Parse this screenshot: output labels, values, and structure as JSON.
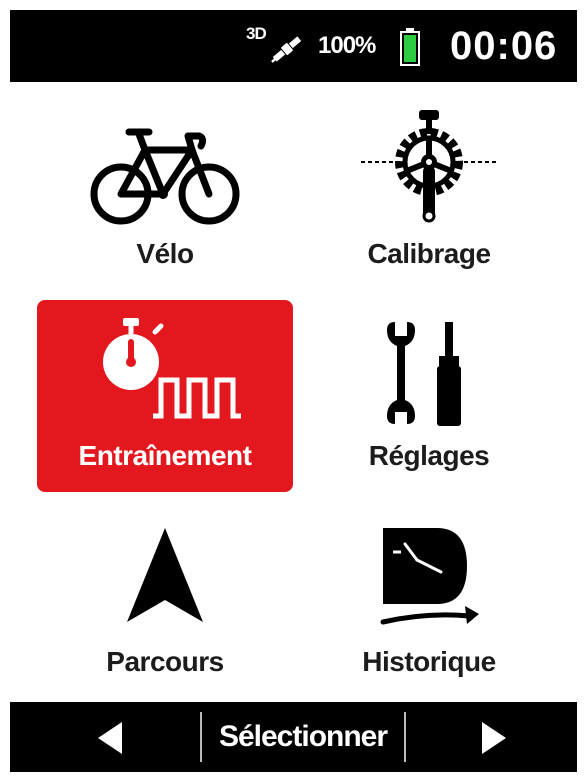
{
  "status_bar": {
    "gps_label": "3D",
    "gps_icon": "satellite-icon",
    "battery_percent": "100%",
    "battery_level": 1.0,
    "battery_color": "#2ecc40",
    "clock": "00:06"
  },
  "menu": {
    "selected_color": "#e3181f",
    "items": [
      {
        "label": "Vélo",
        "icon": "bicycle-icon",
        "selected": false
      },
      {
        "label": "Calibrage",
        "icon": "chainring-icon",
        "selected": false
      },
      {
        "label": "Entraînement",
        "icon": "stopwatch-intervals-icon",
        "selected": true
      },
      {
        "label": "Réglages",
        "icon": "wrench-screwdriver-icon",
        "selected": false
      },
      {
        "label": "Parcours",
        "icon": "navigation-arrow-icon",
        "selected": false
      },
      {
        "label": "Historique",
        "icon": "history-clock-icon",
        "selected": false
      }
    ]
  },
  "bottom_bar": {
    "left_icon": "arrow-left-icon",
    "select_label": "Sélectionner",
    "right_icon": "arrow-right-icon"
  }
}
